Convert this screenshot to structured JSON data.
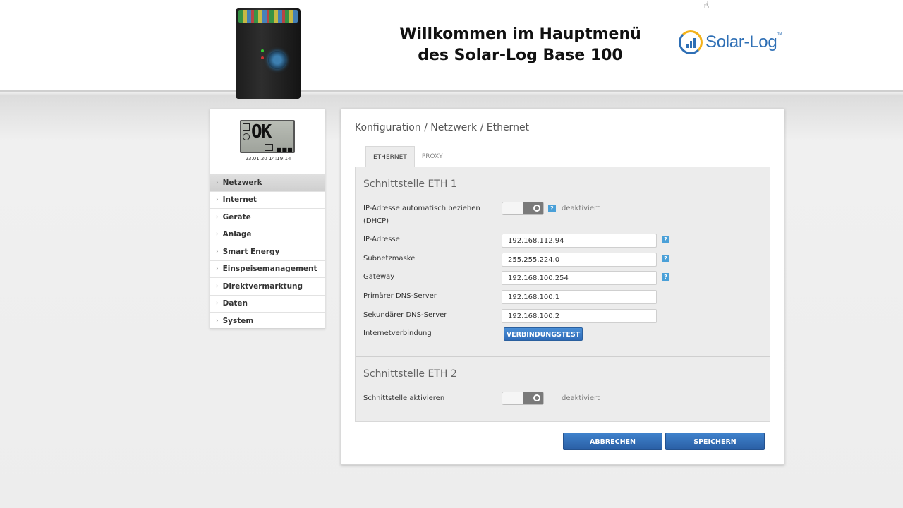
{
  "header": {
    "title_line1": "Willkommen im Hauptmenü",
    "title_line2": "des Solar-Log Base 100",
    "logo_text": "Solar-Log",
    "logo_tm": "™"
  },
  "sidebar": {
    "lcd_text": "OK",
    "lcd_dots": "■■■",
    "date": "23.01.20 14:19:14",
    "items": [
      {
        "label": "Netzwerk"
      },
      {
        "label": "Internet"
      },
      {
        "label": "Geräte"
      },
      {
        "label": "Anlage"
      },
      {
        "label": "Smart Energy"
      },
      {
        "label": "Einspeisemanagement"
      },
      {
        "label": "Direktvermarktung"
      },
      {
        "label": "Daten"
      },
      {
        "label": "System"
      }
    ],
    "arrow": "›"
  },
  "main": {
    "breadcrumb": "Konfiguration / Netzwerk / Ethernet",
    "tabs": [
      {
        "label": "ETHERNET"
      },
      {
        "label": "PROXY"
      }
    ],
    "eth1": {
      "title": "Schnittstelle ETH 1",
      "dhcp_label": "IP-Adresse automatisch beziehen (DHCP)",
      "dhcp_knob": "O",
      "dhcp_status": "deaktiviert",
      "ip_label": "IP-Adresse",
      "ip_value": "192.168.112.94",
      "subnet_label": "Subnetzmaske",
      "subnet_value": "255.255.224.0",
      "gateway_label": "Gateway",
      "gateway_value": "192.168.100.254",
      "dns1_label": "Primärer DNS-Server",
      "dns1_value": "192.168.100.1",
      "dns2_label": "Sekundärer DNS-Server",
      "dns2_value": "192.168.100.2",
      "internet_label": "Internetverbindung",
      "test_button": "VERBINDUNGSTEST",
      "help": "?"
    },
    "eth2": {
      "title": "Schnittstelle ETH 2",
      "enable_label": "Schnittstelle aktivieren",
      "enable_knob": "O",
      "enable_status": "deaktiviert"
    },
    "cancel_button": "ABBRECHEN",
    "save_button": "SPEICHERN"
  },
  "colors": {
    "accent": "#2e6bb8",
    "help": "#4aa0d8",
    "logo_blue": "#2e6fb5",
    "logo_yellow": "#f3b21b"
  }
}
